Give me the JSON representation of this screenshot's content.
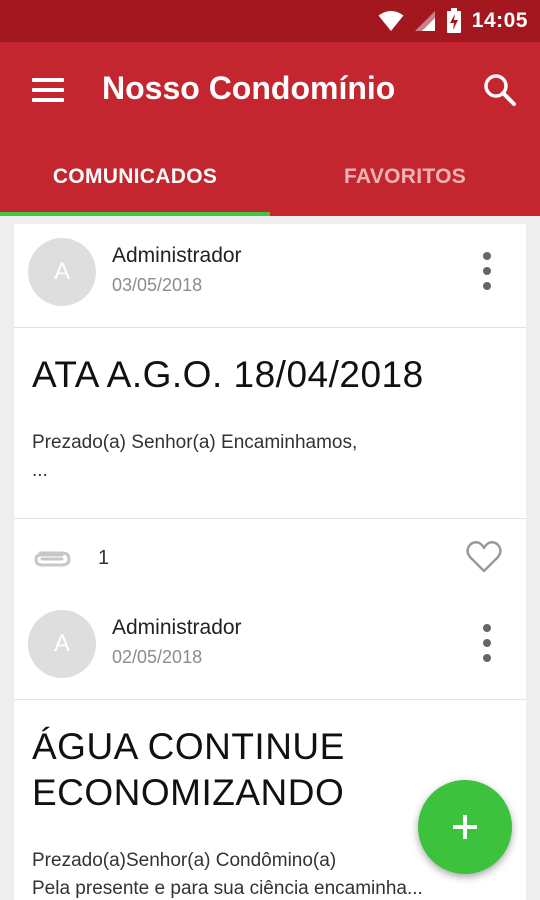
{
  "status_bar": {
    "time": "14:05"
  },
  "app_bar": {
    "title": "Nosso Condomínio"
  },
  "tabs": [
    {
      "label": "COMUNICADOS",
      "active": true
    },
    {
      "label": "FAVORITOS",
      "active": false
    }
  ],
  "posts": [
    {
      "avatar_letter": "A",
      "author": "Administrador",
      "date": "03/05/2018",
      "title_lines": [
        "ATA A.G.O. 18/04/2018"
      ],
      "excerpt_lines": [
        "Prezado(a) Senhor(a) Encaminhamos,",
        "..."
      ],
      "attachment_count": "1"
    },
    {
      "avatar_letter": "A",
      "author": "Administrador",
      "date": "02/05/2018",
      "title_lines": [
        "ÁGUA CONTINUE",
        "ECONOMIZANDO"
      ],
      "excerpt_lines": [
        "Prezado(a)Senhor(a) Condômino(a)",
        "Pela presente e para sua ciência encaminha..."
      ]
    }
  ],
  "colors": {
    "app_bar": "#c3262e",
    "status_bar": "#a3171f",
    "tab_indicator": "#43c444",
    "fab": "#3cc23c"
  },
  "icons": {
    "menu": "hamburger-icon",
    "search": "search-icon",
    "more": "more-vert-icon",
    "attachment": "paperclip-icon",
    "favorite": "heart-outline-icon",
    "fab": "plus-icon"
  }
}
